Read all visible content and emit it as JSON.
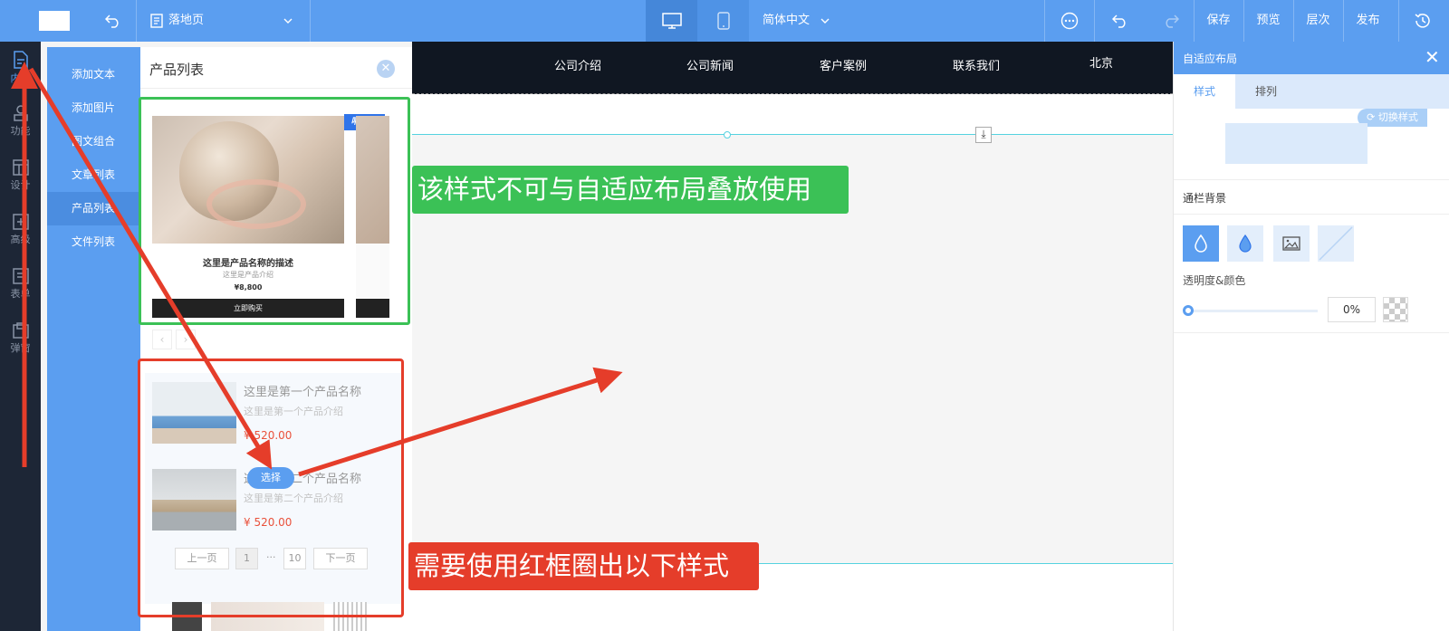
{
  "topbar": {
    "page_name": "落地页",
    "language": "简体中文",
    "save": "保存",
    "preview": "预览",
    "layers": "层次",
    "publish": "发布"
  },
  "leftrail": {
    "items": [
      {
        "label": "内容",
        "icon": "document-icon"
      },
      {
        "label": "功能",
        "icon": "function-icon"
      },
      {
        "label": "设计",
        "icon": "design-icon"
      },
      {
        "label": "高级",
        "icon": "advanced-icon"
      },
      {
        "label": "表单",
        "icon": "form-icon"
      },
      {
        "label": "弹窗",
        "icon": "popup-icon"
      }
    ]
  },
  "subnav": {
    "items": [
      {
        "label": "添加文本"
      },
      {
        "label": "添加图片"
      },
      {
        "label": "图文组合"
      },
      {
        "label": "文章列表"
      },
      {
        "label": "产品列表"
      },
      {
        "label": "文件列表"
      }
    ]
  },
  "panel": {
    "title": "产品列表",
    "card1": {
      "badge": "响应式",
      "name": "这里是产品名称的描述",
      "desc": "这里是产品介绍",
      "price": "¥8,800",
      "buy": "立即购买"
    },
    "list": [
      {
        "name": "这里是第一个产品名称",
        "desc": "这里是第一个产品介绍",
        "price": "¥ 520.00"
      },
      {
        "name": "这里是第二个产品名称",
        "desc": "这里是第二个产品介绍",
        "price": "¥ 520.00"
      }
    ],
    "pager": {
      "prev": "上一页",
      "current": "1",
      "dots": "···",
      "last": "10",
      "next": "下一页"
    },
    "select_label": "选择"
  },
  "canvas": {
    "nav": [
      "公司介绍",
      "公司新闻",
      "客户案例",
      "联系我们",
      "北京"
    ]
  },
  "rightpanel": {
    "title": "自适应布局",
    "tabs": [
      "样式",
      "排列"
    ],
    "switch_style": "切换样式",
    "section_bg": "通栏背景",
    "opacity_label": "透明度&颜色",
    "opacity_value": "0%"
  },
  "annotations": {
    "green": "该样式不可与自适应布局叠放使用",
    "red": "需要使用红框圈出以下样式"
  },
  "colors": {
    "brand": "#5b9ef0",
    "annotation_green": "#3bc156",
    "annotation_red": "#e53d2a",
    "price_red": "#e9513b"
  }
}
